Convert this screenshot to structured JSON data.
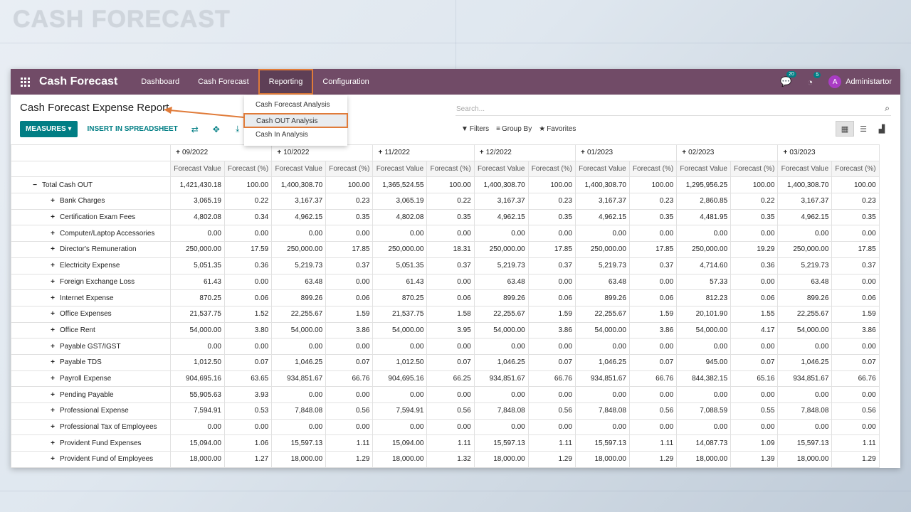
{
  "banner": {
    "title": "CASH FORECAST"
  },
  "navbar": {
    "brand": "Cash Forecast",
    "menu": [
      "Dashboard",
      "Cash Forecast",
      "Reporting",
      "Configuration"
    ],
    "messages_count": "20",
    "activities_count": "5",
    "user_initial": "A",
    "user_name": "Administartor"
  },
  "dropdown": [
    "Cash Forecast Analysis",
    "Cash OUT Analysis",
    "Cash In Analysis"
  ],
  "control": {
    "title": "Cash Forecast Expense Report",
    "measures": "MEASURES",
    "insert": "INSERT IN SPREADSHEET",
    "search_placeholder": "Search...",
    "filters": "Filters",
    "group_by": "Group By",
    "favorites": "Favorites"
  },
  "table": {
    "months": [
      "09/2022",
      "10/2022",
      "11/2022",
      "12/2022",
      "01/2023",
      "02/2023",
      "03/2023"
    ],
    "measure_headers": [
      "Forecast Value",
      "Forecast (%)"
    ],
    "total_label": "Total Cash OUT",
    "rows": [
      {
        "label": "Total Cash OUT",
        "values": [
          "1,421,430.18",
          "100.00",
          "1,400,308.70",
          "100.00",
          "1,365,524.55",
          "100.00",
          "1,400,308.70",
          "100.00",
          "1,400,308.70",
          "100.00",
          "1,295,956.25",
          "100.00",
          "1,400,308.70",
          "100.00"
        ]
      },
      {
        "label": "Bank Charges",
        "values": [
          "3,065.19",
          "0.22",
          "3,167.37",
          "0.23",
          "3,065.19",
          "0.22",
          "3,167.37",
          "0.23",
          "3,167.37",
          "0.23",
          "2,860.85",
          "0.22",
          "3,167.37",
          "0.23"
        ]
      },
      {
        "label": "Certification Exam Fees",
        "values": [
          "4,802.08",
          "0.34",
          "4,962.15",
          "0.35",
          "4,802.08",
          "0.35",
          "4,962.15",
          "0.35",
          "4,962.15",
          "0.35",
          "4,481.95",
          "0.35",
          "4,962.15",
          "0.35"
        ]
      },
      {
        "label": "Computer/Laptop Accessories",
        "values": [
          "0.00",
          "0.00",
          "0.00",
          "0.00",
          "0.00",
          "0.00",
          "0.00",
          "0.00",
          "0.00",
          "0.00",
          "0.00",
          "0.00",
          "0.00",
          "0.00"
        ]
      },
      {
        "label": "Director's Remuneration",
        "values": [
          "250,000.00",
          "17.59",
          "250,000.00",
          "17.85",
          "250,000.00",
          "18.31",
          "250,000.00",
          "17.85",
          "250,000.00",
          "17.85",
          "250,000.00",
          "19.29",
          "250,000.00",
          "17.85"
        ]
      },
      {
        "label": "Electricity Expense",
        "values": [
          "5,051.35",
          "0.36",
          "5,219.73",
          "0.37",
          "5,051.35",
          "0.37",
          "5,219.73",
          "0.37",
          "5,219.73",
          "0.37",
          "4,714.60",
          "0.36",
          "5,219.73",
          "0.37"
        ]
      },
      {
        "label": "Foreign Exchange Loss",
        "values": [
          "61.43",
          "0.00",
          "63.48",
          "0.00",
          "61.43",
          "0.00",
          "63.48",
          "0.00",
          "63.48",
          "0.00",
          "57.33",
          "0.00",
          "63.48",
          "0.00"
        ]
      },
      {
        "label": "Internet Expense",
        "values": [
          "870.25",
          "0.06",
          "899.26",
          "0.06",
          "870.25",
          "0.06",
          "899.26",
          "0.06",
          "899.26",
          "0.06",
          "812.23",
          "0.06",
          "899.26",
          "0.06"
        ]
      },
      {
        "label": "Office Expenses",
        "values": [
          "21,537.75",
          "1.52",
          "22,255.67",
          "1.59",
          "21,537.75",
          "1.58",
          "22,255.67",
          "1.59",
          "22,255.67",
          "1.59",
          "20,101.90",
          "1.55",
          "22,255.67",
          "1.59"
        ]
      },
      {
        "label": "Office Rent",
        "values": [
          "54,000.00",
          "3.80",
          "54,000.00",
          "3.86",
          "54,000.00",
          "3.95",
          "54,000.00",
          "3.86",
          "54,000.00",
          "3.86",
          "54,000.00",
          "4.17",
          "54,000.00",
          "3.86"
        ]
      },
      {
        "label": "Payable GST/IGST",
        "values": [
          "0.00",
          "0.00",
          "0.00",
          "0.00",
          "0.00",
          "0.00",
          "0.00",
          "0.00",
          "0.00",
          "0.00",
          "0.00",
          "0.00",
          "0.00",
          "0.00"
        ]
      },
      {
        "label": "Payable TDS",
        "values": [
          "1,012.50",
          "0.07",
          "1,046.25",
          "0.07",
          "1,012.50",
          "0.07",
          "1,046.25",
          "0.07",
          "1,046.25",
          "0.07",
          "945.00",
          "0.07",
          "1,046.25",
          "0.07"
        ]
      },
      {
        "label": "Payroll Expense",
        "values": [
          "904,695.16",
          "63.65",
          "934,851.67",
          "66.76",
          "904,695.16",
          "66.25",
          "934,851.67",
          "66.76",
          "934,851.67",
          "66.76",
          "844,382.15",
          "65.16",
          "934,851.67",
          "66.76"
        ]
      },
      {
        "label": "Pending Payable",
        "values": [
          "55,905.63",
          "3.93",
          "0.00",
          "0.00",
          "0.00",
          "0.00",
          "0.00",
          "0.00",
          "0.00",
          "0.00",
          "0.00",
          "0.00",
          "0.00",
          "0.00"
        ]
      },
      {
        "label": "Professional Expense",
        "values": [
          "7,594.91",
          "0.53",
          "7,848.08",
          "0.56",
          "7,594.91",
          "0.56",
          "7,848.08",
          "0.56",
          "7,848.08",
          "0.56",
          "7,088.59",
          "0.55",
          "7,848.08",
          "0.56"
        ]
      },
      {
        "label": "Professional Tax of Employees",
        "values": [
          "0.00",
          "0.00",
          "0.00",
          "0.00",
          "0.00",
          "0.00",
          "0.00",
          "0.00",
          "0.00",
          "0.00",
          "0.00",
          "0.00",
          "0.00",
          "0.00"
        ]
      },
      {
        "label": "Provident Fund Expenses",
        "values": [
          "15,094.00",
          "1.06",
          "15,597.13",
          "1.11",
          "15,094.00",
          "1.11",
          "15,597.13",
          "1.11",
          "15,597.13",
          "1.11",
          "14,087.73",
          "1.09",
          "15,597.13",
          "1.11"
        ]
      },
      {
        "label": "Provident Fund of Employees",
        "values": [
          "18,000.00",
          "1.27",
          "18,000.00",
          "1.29",
          "18,000.00",
          "1.32",
          "18,000.00",
          "1.29",
          "18,000.00",
          "1.29",
          "18,000.00",
          "1.39",
          "18,000.00",
          "1.29"
        ]
      }
    ]
  },
  "colors": {
    "navbar": "#714b67",
    "accent": "#017e84",
    "highlight": "#e07b39"
  }
}
